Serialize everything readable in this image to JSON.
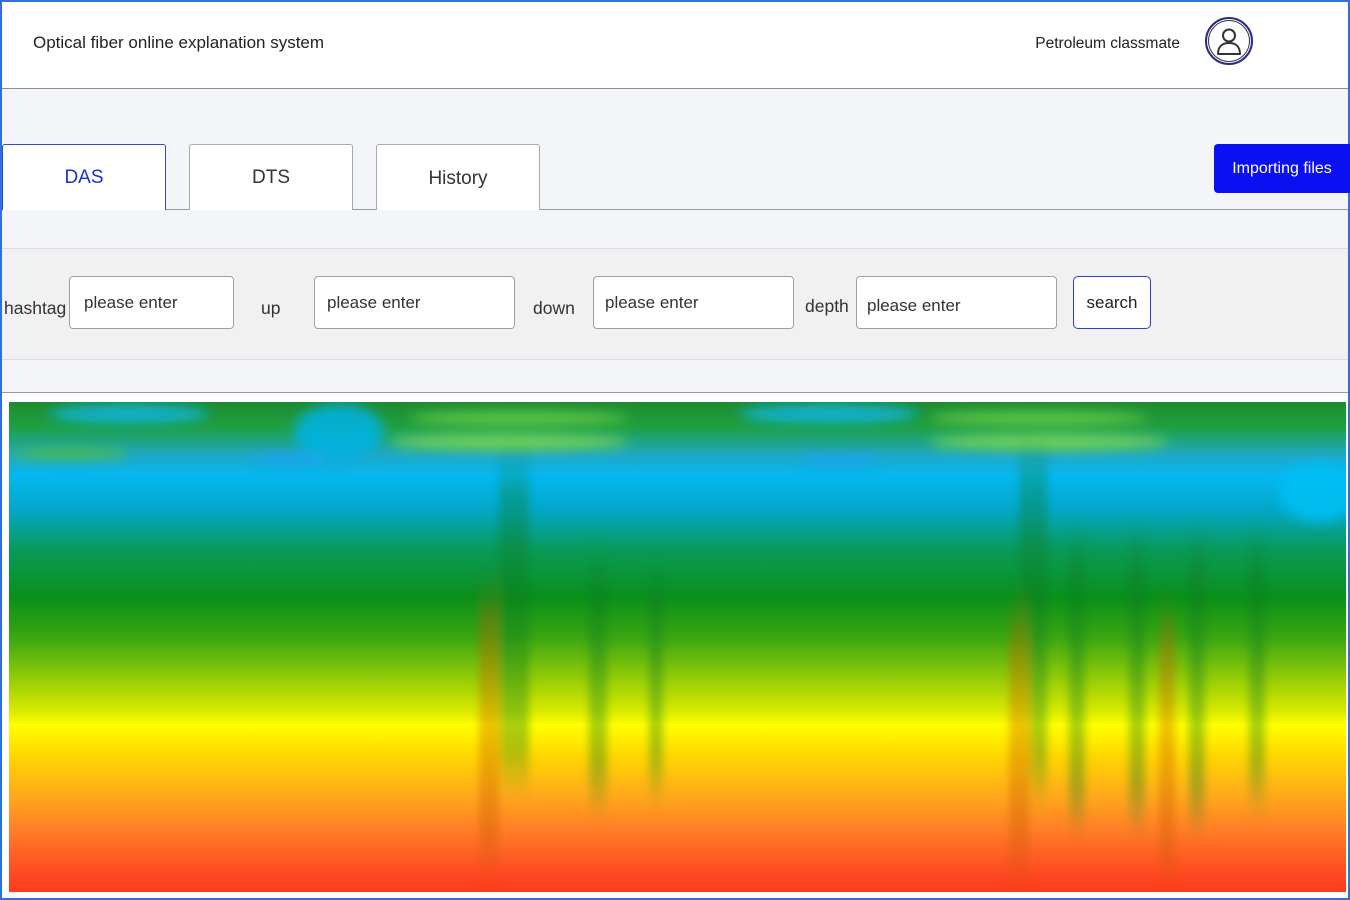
{
  "header": {
    "title": "Optical fiber online explanation system",
    "user_name": "Petroleum classmate",
    "avatar_icon": "user-avatar-icon"
  },
  "tabs": [
    {
      "label": "DAS",
      "active": true
    },
    {
      "label": "DTS",
      "active": false
    },
    {
      "label": "History",
      "active": false
    }
  ],
  "actions": {
    "import_label": "Importing files"
  },
  "filters": {
    "hashtag_label": "hashtag",
    "hashtag_placeholder": "please enter",
    "up_label": "up",
    "up_placeholder": "please enter",
    "down_label": "down",
    "down_placeholder": "please enter",
    "depth_label": "depth",
    "depth_placeholder": "please enter",
    "search_label": "search"
  },
  "colors": {
    "frame_border": "#2f6fe0",
    "accent": "#0a10f0",
    "active_tab_text": "#1a2fd8"
  },
  "heatmap": {
    "colormap": [
      "#1f8a30",
      "#05b7ef",
      "#0b8f1a",
      "#ffff00",
      "#ff3a1e"
    ]
  }
}
